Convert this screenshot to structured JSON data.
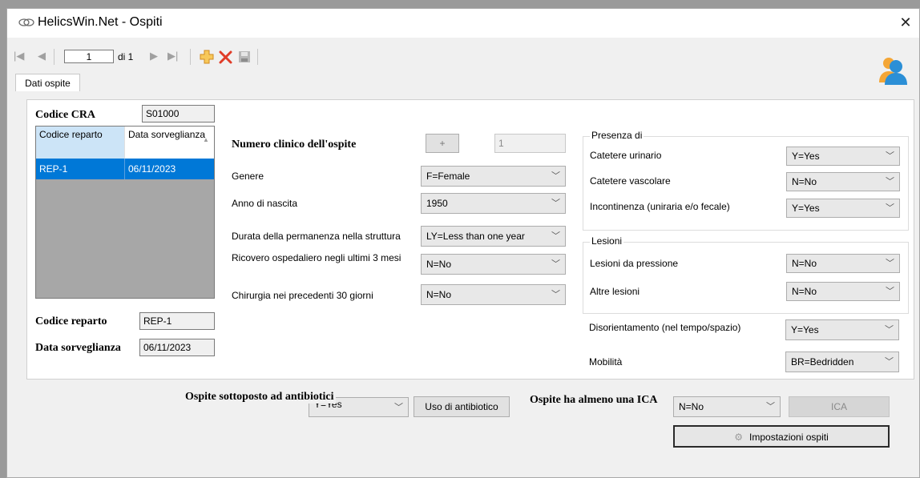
{
  "window": {
    "title": "HelicsWin.Net - Ospiti"
  },
  "navigator": {
    "current_page": "1",
    "of_label": "di 1"
  },
  "tabs": [
    "Dati ospite"
  ],
  "left": {
    "codice_cra_label": "Codice CRA",
    "codice_cra_value": "S01000",
    "grid": {
      "headers": [
        "Codice reparto",
        "Data sorveglianza"
      ],
      "rows": [
        [
          "REP-1",
          "06/11/2023"
        ]
      ]
    },
    "codice_reparto_label": "Codice reparto",
    "codice_reparto_value": "REP-1",
    "data_sorveglianza_label": "Data sorveglianza",
    "data_sorveglianza_value": "06/11/2023"
  },
  "middle": {
    "numero_clinico_label": "Numero clinico dell'ospite",
    "plus_label": "+",
    "numero_clinico_value": "1",
    "fields": [
      {
        "label": "Genere",
        "value": "F=Female"
      },
      {
        "label": "Anno di nascita",
        "value": "1950"
      },
      {
        "label": "Durata della permanenza nella struttura",
        "value": "LY=Less than one year"
      },
      {
        "label": "Ricovero ospedaliero negli ultimi 3 mesi",
        "value": "N=No"
      },
      {
        "label": "Chirurgia nei precedenti 30 giorni",
        "value": "N=No"
      }
    ]
  },
  "right": {
    "presenza_title": "Presenza di",
    "presenza": [
      {
        "label": "Catetere urinario",
        "value": "Y=Yes"
      },
      {
        "label": "Catetere vascolare",
        "value": "N=No"
      },
      {
        "label": "Incontinenza (uniraria e/o fecale)",
        "value": "Y=Yes"
      }
    ],
    "lesioni_title": "Lesioni",
    "lesioni": [
      {
        "label": "Lesioni da pressione",
        "value": "N=No"
      },
      {
        "label": "Altre lesioni",
        "value": "N=No"
      }
    ],
    "disorientamento": {
      "label": "Disorientamento (nel tempo/spazio)",
      "value": "Y=Yes"
    },
    "mobilita": {
      "label": "Mobilità",
      "value": "BR=Bedridden"
    }
  },
  "bottom": {
    "antibiotici_label": "Ospite sottoposto ad antibiotici",
    "antibiotici_value": "Y=Yes",
    "uso_antibiotico_button": "Uso di antibiotico",
    "ica_label": "Ospite ha almeno una ICA",
    "ica_value": "N=No",
    "ica_button": "ICA",
    "impostazioni_button": "Impostazioni ospiti"
  },
  "colors": {
    "selection": "#0078d7",
    "accent_orange": "#f0a030",
    "delete_red": "#e03c28"
  }
}
